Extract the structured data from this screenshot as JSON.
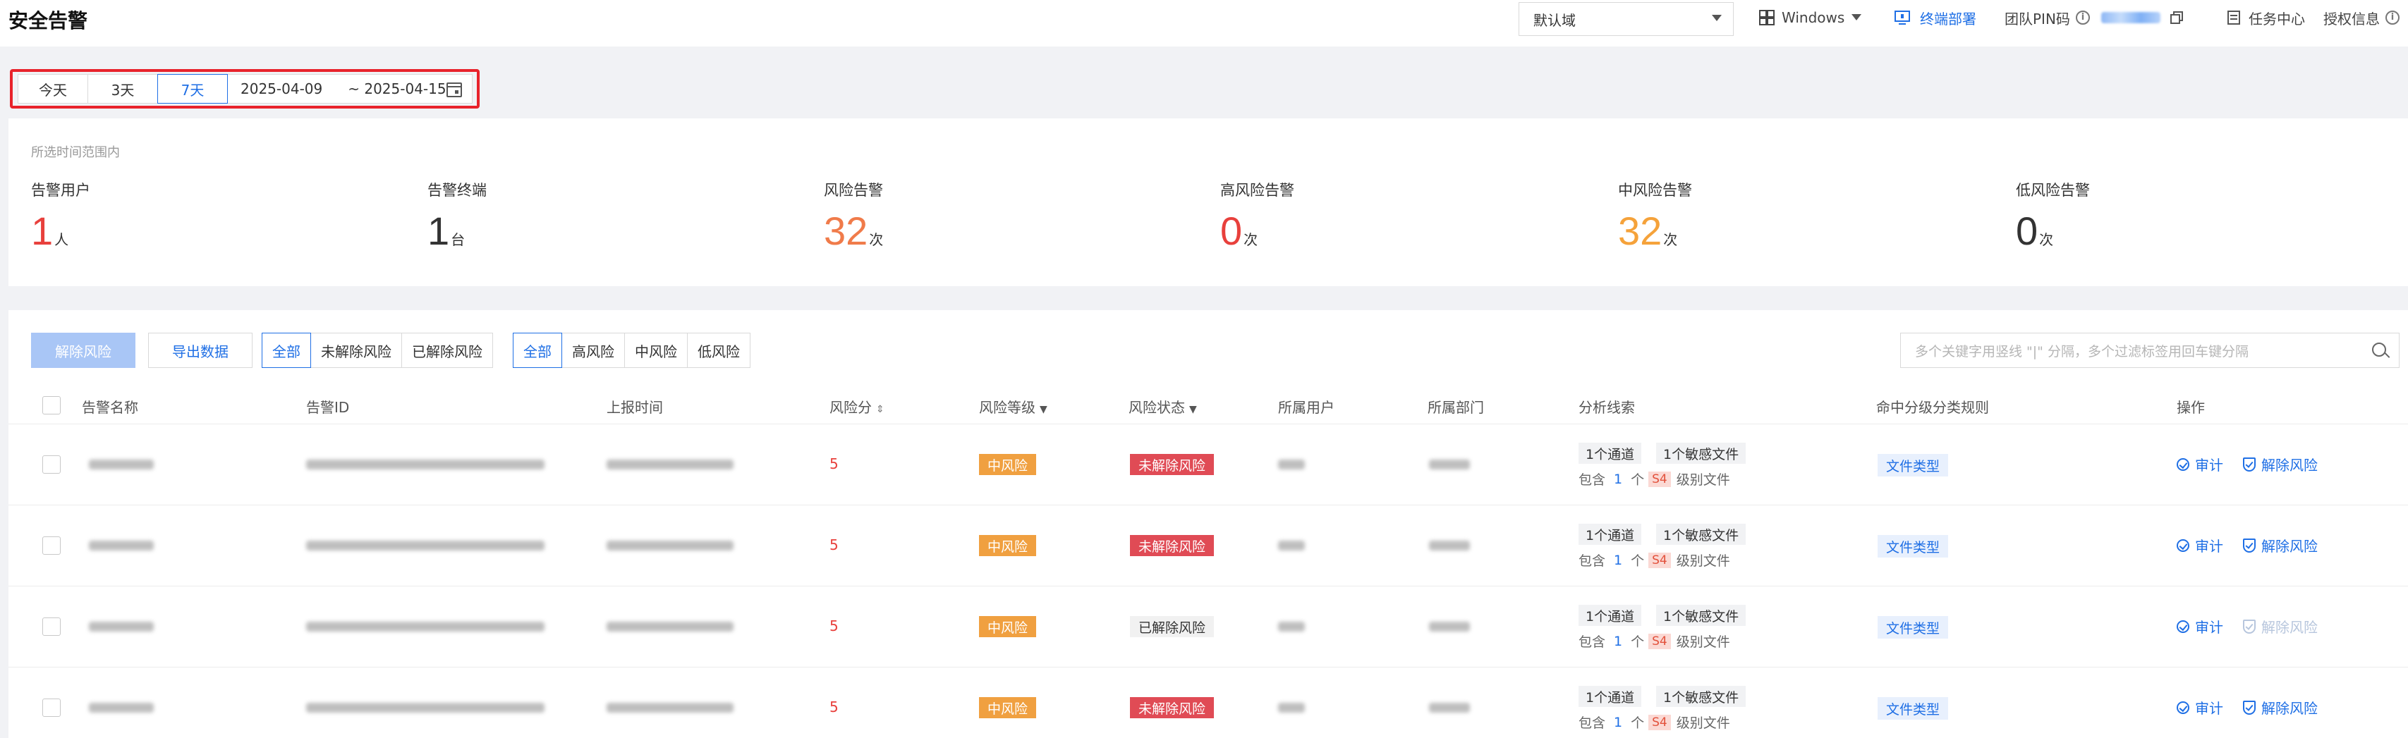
{
  "header": {
    "title": "安全告警",
    "domain_select": "默认域",
    "os_label": "Windows",
    "deploy_label": "终端部署",
    "pin_label": "团队PIN码",
    "task_center": "任务中心",
    "license_info": "授权信息"
  },
  "date_filter": {
    "options": [
      "今天",
      "3天",
      "7天"
    ],
    "active": "7天",
    "start": "2025-04-09",
    "end": "~ 2025-04-15"
  },
  "stats": {
    "caption": "所选时间范围内",
    "items": [
      {
        "label": "告警用户",
        "value": "1",
        "unit": "人",
        "color": "#e8403c"
      },
      {
        "label": "告警终端",
        "value": "1",
        "unit": "台",
        "color": "#333333"
      },
      {
        "label": "风险告警",
        "value": "32",
        "unit": "次",
        "color": "#f07b4a"
      },
      {
        "label": "高风险告警",
        "value": "0",
        "unit": "次",
        "color": "#e8403c"
      },
      {
        "label": "中风险告警",
        "value": "32",
        "unit": "次",
        "color": "#f5a23a"
      },
      {
        "label": "低风险告警",
        "value": "0",
        "unit": "次",
        "color": "#333333"
      }
    ]
  },
  "toolbar": {
    "resolve_button": "解除风险",
    "export_button": "导出数据",
    "status_filter": [
      "全部",
      "未解除风险",
      "已解除风险"
    ],
    "level_filter": [
      "全部",
      "高风险",
      "中风险",
      "低风险"
    ],
    "search_placeholder": "多个关键字用竖线 \"|\" 分隔，多个过滤标签用回车键分隔"
  },
  "table": {
    "columns": [
      "告警名称",
      "告警ID",
      "上报时间",
      "风险分",
      "风险等级",
      "风险状态",
      "所属用户",
      "所属部门",
      "分析线索",
      "命中分级分类规则",
      "操作"
    ],
    "rows": [
      {
        "score": "5",
        "level": "中风险",
        "status": "未解除风险",
        "status_type": "unresolved",
        "channel": "1个通道",
        "files": "1个敏感文件",
        "contain": "包含",
        "count": "1",
        "count_unit": "个",
        "grade": "S4",
        "grade_suffix": "级别文件",
        "rule": "文件类型",
        "audit": "审计",
        "resolve": "解除风险",
        "resolve_enabled": true
      },
      {
        "score": "5",
        "level": "中风险",
        "status": "未解除风险",
        "status_type": "unresolved",
        "channel": "1个通道",
        "files": "1个敏感文件",
        "contain": "包含",
        "count": "1",
        "count_unit": "个",
        "grade": "S4",
        "grade_suffix": "级别文件",
        "rule": "文件类型",
        "audit": "审计",
        "resolve": "解除风险",
        "resolve_enabled": true
      },
      {
        "score": "5",
        "level": "中风险",
        "status": "已解除风险",
        "status_type": "resolved",
        "channel": "1个通道",
        "files": "1个敏感文件",
        "contain": "包含",
        "count": "1",
        "count_unit": "个",
        "grade": "S4",
        "grade_suffix": "级别文件",
        "rule": "文件类型",
        "audit": "审计",
        "resolve": "解除风险",
        "resolve_enabled": false
      },
      {
        "score": "5",
        "level": "中风险",
        "status": "未解除风险",
        "status_type": "unresolved",
        "channel": "1个通道",
        "files": "1个敏感文件",
        "contain": "包含",
        "count": "1",
        "count_unit": "个",
        "grade": "S4",
        "grade_suffix": "级别文件",
        "rule": "文件类型",
        "audit": "审计",
        "resolve": "解除风险",
        "resolve_enabled": true
      }
    ]
  },
  "colors": {
    "accent": "#1f6fe5",
    "highlight_frame": "#e8232b",
    "tag_medium": "#f0a040",
    "tag_unresolved": "#e04b55"
  }
}
